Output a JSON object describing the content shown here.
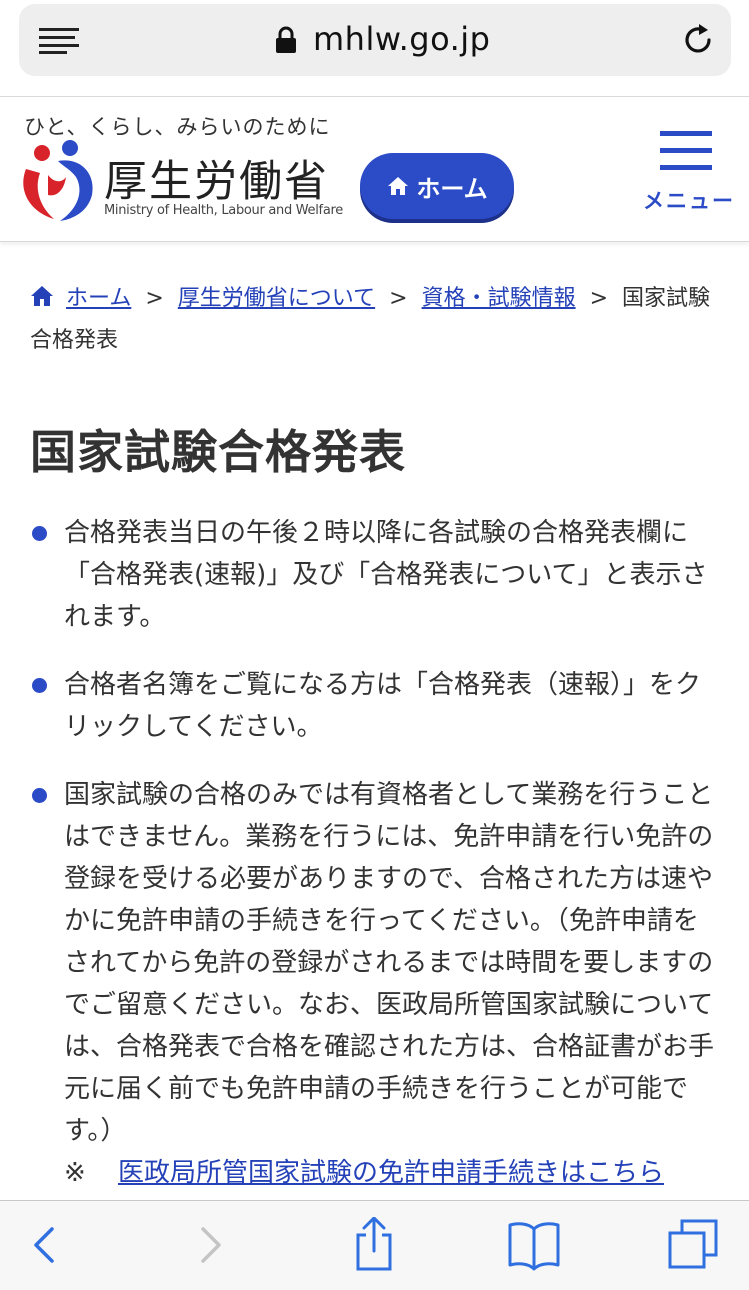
{
  "browser": {
    "url": "mhlw.go.jp",
    "icons": [
      "reader-icon",
      "lock-icon",
      "reload-icon"
    ]
  },
  "header": {
    "tagline": "ひと、くらし、みらいのために",
    "ministry_name": "厚生労働省",
    "ministry_name_en": "Ministry of Health, Labour and Welfare",
    "home_label": "ホーム",
    "menu_label": "メニュー",
    "colors": {
      "accent": "#2b4bc7",
      "logo_red": "#d9232a",
      "logo_blue": "#2b4bc7"
    }
  },
  "breadcrumb": {
    "items": [
      "ホーム",
      "厚生労働省について",
      "資格・試験情報"
    ],
    "separator": ">",
    "current": "国家試験合格発表"
  },
  "page": {
    "title": "国家試験合格発表",
    "bullets": [
      "合格発表当日の午後２時以降に各試験の合格発表欄に「合格発表(速報)」及び「合格発表について」と表示されます。",
      "合格者名簿をご覧になる方は「合格発表（速報）」をクリックしてください。",
      "国家試験の合格のみでは有資格者として業務を行うことはできません。業務を行うには、免許申請を行い免許の登録を受ける必要がありますので、合格された方は速やかに免許申請の手続きを行ってください。（免許申請をされてから免許の登録がされるまでは時間を要しますのでご留意ください。なお、医政局所管国家試験については、合格発表で合格を確認された方は、合格証書がお手元に届く前でも免許申請の手続きを行うことが可能です。）"
    ],
    "note_mark": "※",
    "note_link": "医政局所管国家試験の免許申請手続きはこちら"
  },
  "toolbar": {
    "icons": [
      "back-icon",
      "forward-icon",
      "share-icon",
      "bookmarks-icon",
      "tabs-icon"
    ],
    "colors": {
      "active": "#2f6fe0",
      "disabled": "#c4c4c4"
    }
  }
}
